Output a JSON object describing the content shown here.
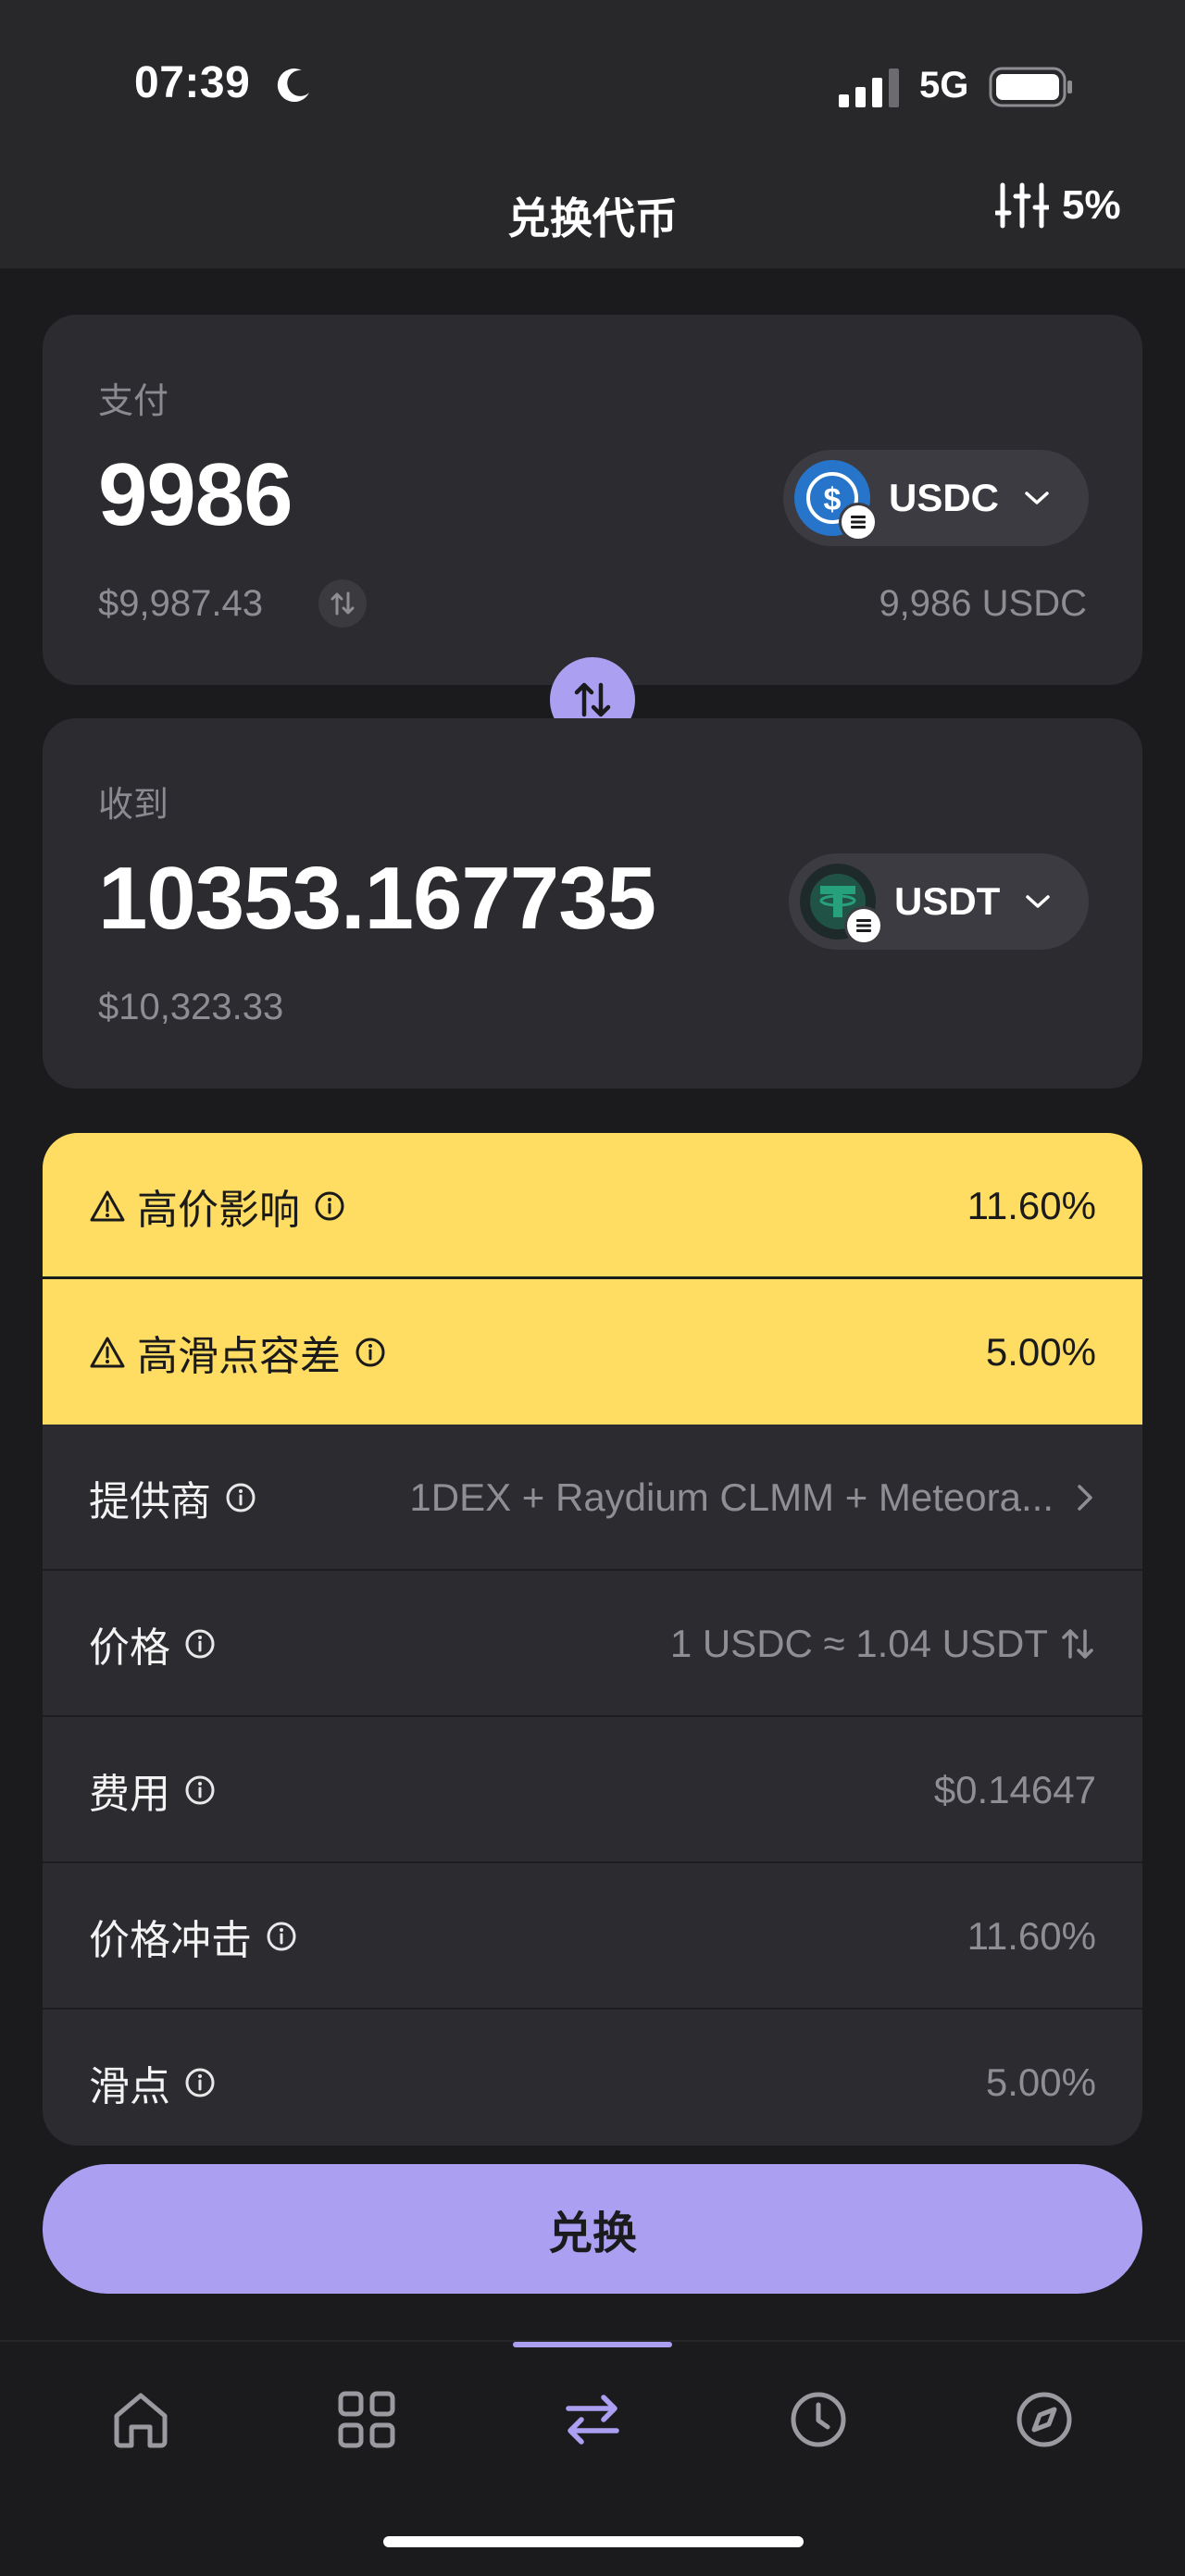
{
  "status_bar": {
    "time": "07:39",
    "network": "5G"
  },
  "header": {
    "title": "兑换代币",
    "slippage": "5%"
  },
  "pay": {
    "label": "支付",
    "amount": "9986",
    "usd_value": "$9,987.43",
    "token": "USDC",
    "balance": "9,986 USDC"
  },
  "receive": {
    "label": "收到",
    "amount": "10353.167735",
    "usd_value": "$10,323.33",
    "token": "USDT"
  },
  "warnings": [
    {
      "label": "高价影响",
      "value": "11.60%"
    },
    {
      "label": "高滑点容差",
      "value": "5.00%"
    }
  ],
  "details": [
    {
      "label": "提供商",
      "value": "1DEX + Raydium CLMM + Meteora..."
    },
    {
      "label": "价格",
      "value": "1 USDC ≈ 1.04 USDT"
    },
    {
      "label": "费用",
      "value": "$0.14647"
    },
    {
      "label": "价格冲击",
      "value": "11.60%"
    },
    {
      "label": "滑点",
      "value": "5.00%"
    }
  ],
  "action": {
    "label": "兑换"
  },
  "nav": {
    "items": [
      "home-icon",
      "grid-icon",
      "swap-icon",
      "history-icon",
      "explore-icon"
    ],
    "active": "swap-icon"
  },
  "colors": {
    "accent": "#ab9ff2",
    "warning": "#ffdc62",
    "card": "#2b2b30",
    "background": "#1b1b1e"
  }
}
